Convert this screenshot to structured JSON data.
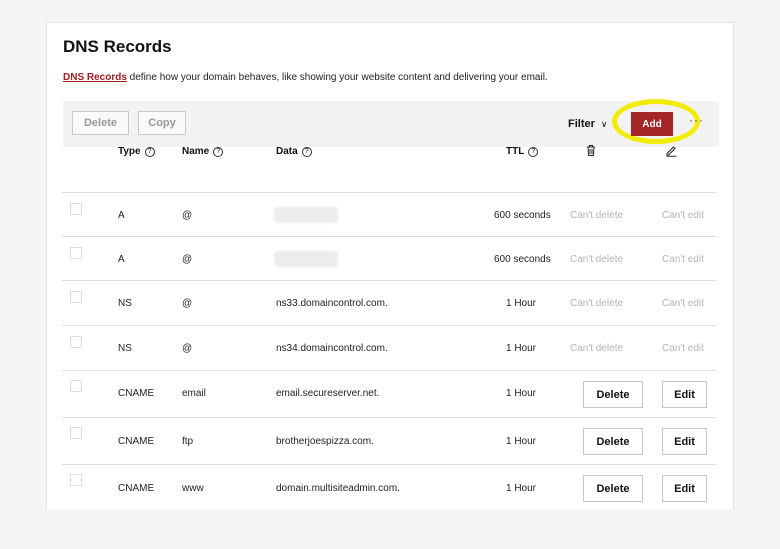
{
  "page": {
    "title": "DNS Records",
    "description_link": "DNS Records",
    "description_rest": " define how your domain behaves, like showing your website content and delivering your email."
  },
  "toolbar": {
    "delete_label": "Delete",
    "copy_label": "Copy",
    "filter_label": "Filter",
    "add_label": "Add",
    "more_label": "···"
  },
  "columns": {
    "type": "Type",
    "name": "Name",
    "data": "Data",
    "ttl": "TTL"
  },
  "records": [
    {
      "type": "A",
      "name": "@",
      "data": "",
      "ttl": "600 seconds",
      "delete": "Can't delete",
      "edit": "Can't edit",
      "editable": false
    },
    {
      "type": "A",
      "name": "@",
      "data": "",
      "ttl": "600 seconds",
      "delete": "Can't delete",
      "edit": "Can't edit",
      "editable": false
    },
    {
      "type": "NS",
      "name": "@",
      "data": "ns33.domaincontrol.com.",
      "ttl": "1 Hour",
      "delete": "Can't delete",
      "edit": "Can't edit",
      "editable": false
    },
    {
      "type": "NS",
      "name": "@",
      "data": "ns34.domaincontrol.com.",
      "ttl": "1 Hour",
      "delete": "Can't delete",
      "edit": "Can't edit",
      "editable": false
    },
    {
      "type": "CNAME",
      "name": "email",
      "data": "email.secureserver.net.",
      "ttl": "1 Hour",
      "delete": "Delete",
      "edit": "Edit",
      "editable": true
    },
    {
      "type": "CNAME",
      "name": "ftp",
      "data": "brotherjoespizza.com.",
      "ttl": "1 Hour",
      "delete": "Delete",
      "edit": "Edit",
      "editable": true
    },
    {
      "type": "CNAME",
      "name": "www",
      "data": "domain.multisiteadmin.com.",
      "ttl": "1 Hour",
      "delete": "Delete",
      "edit": "Edit",
      "editable": true
    }
  ],
  "colors": {
    "accent": "#a52525",
    "highlight": "#f2ec05"
  }
}
